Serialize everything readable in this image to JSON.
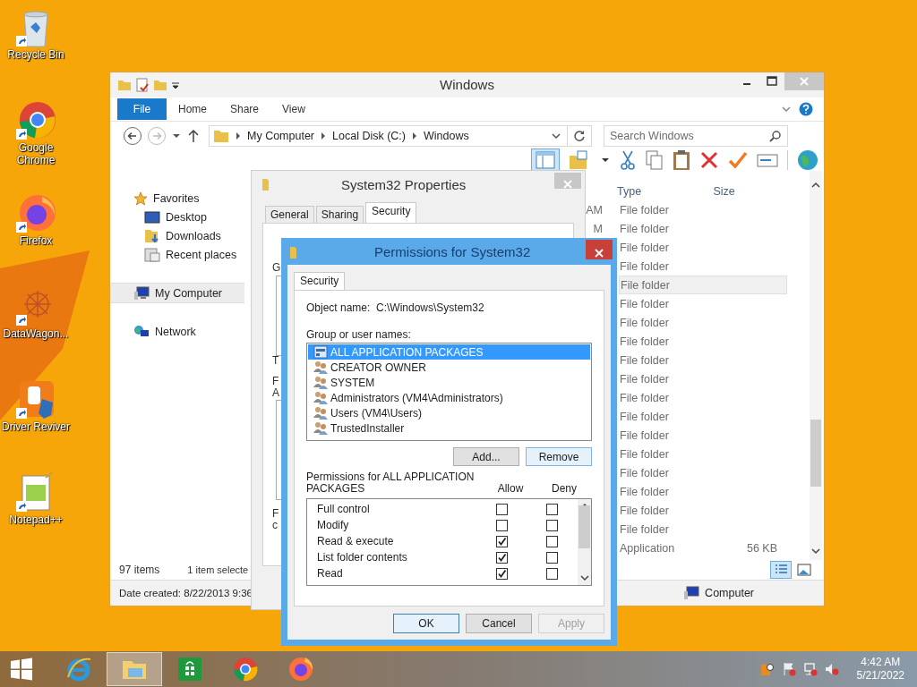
{
  "desktop_icons": [
    {
      "kind": "recycle",
      "label": "Recycle Bin"
    },
    {
      "kind": "chrome",
      "label": "Google Chrome"
    },
    {
      "kind": "firefox",
      "label": "Firefox"
    },
    {
      "kind": "datawagon",
      "label": "DataWagon..."
    },
    {
      "kind": "driver",
      "label": "Driver Reviver"
    },
    {
      "kind": "notepad",
      "label": "Notepad++"
    }
  ],
  "explorer": {
    "title": "Windows",
    "file_tab": "File",
    "ribbon_tabs": [
      "Home",
      "Share",
      "View"
    ],
    "breadcrumb": [
      "My Computer",
      "Local Disk (C:)",
      "Windows"
    ],
    "search": {
      "placeholder": "Search Windows"
    },
    "nav": [
      {
        "label": "Favorites",
        "kind": "favorites",
        "selected": false,
        "children": [
          {
            "label": "Desktop",
            "kind": "desktop",
            "selected": false
          },
          {
            "label": "Downloads",
            "kind": "downloads",
            "selected": false
          },
          {
            "label": "Recent places",
            "kind": "recent",
            "selected": false
          }
        ]
      },
      {
        "label": "My Computer",
        "kind": "computer",
        "selected": true
      },
      {
        "label": "Network",
        "kind": "network",
        "selected": false
      }
    ],
    "columns": [
      "Type",
      "Size"
    ],
    "rows": [
      {
        "date": "AM",
        "type": "File folder",
        "selected": false
      },
      {
        "date": "M",
        "type": "File folder",
        "selected": false
      },
      {
        "type": "File folder",
        "selected": false
      },
      {
        "type": "File folder",
        "selected": false
      },
      {
        "type": "File folder",
        "selected": true
      },
      {
        "type": "File folder",
        "selected": false
      },
      {
        "type": "File folder",
        "selected": false
      },
      {
        "type": "File folder",
        "selected": false
      },
      {
        "type": "File folder",
        "selected": false
      },
      {
        "type": "File folder",
        "selected": false
      },
      {
        "type": "File folder",
        "selected": false
      },
      {
        "type": "File folder",
        "selected": false
      },
      {
        "type": "File folder",
        "selected": false
      },
      {
        "type": "File folder",
        "selected": false
      },
      {
        "type": "File folder",
        "selected": false
      },
      {
        "type": "File folder",
        "selected": false
      },
      {
        "type": "File folder",
        "selected": false
      },
      {
        "type": "File folder",
        "selected": false
      },
      {
        "type": "Application",
        "size": "56 KB",
        "selected": false
      }
    ],
    "status": {
      "count": "97 items",
      "selection": "1 item selecte",
      "details": "Date created: 8/22/2013 9:36",
      "location": "Computer"
    }
  },
  "properties": {
    "title": "System32 Properties",
    "tabs": [
      {
        "label": "General",
        "selected": false
      },
      {
        "label": "Sharing",
        "selected": false
      },
      {
        "label": "Security",
        "selected": true
      }
    ],
    "fragments": [
      "G",
      "T",
      "F",
      "A",
      "F",
      "c"
    ]
  },
  "permissions": {
    "title": "Permissions for System32",
    "tab": "Security",
    "object_label": "Object name:",
    "object_value": "C:\\Windows\\System32",
    "group_label": "Group or user names:",
    "principals": [
      {
        "name": "ALL APPLICATION PACKAGES",
        "kind": "package",
        "selected": true
      },
      {
        "name": "CREATOR OWNER",
        "kind": "group",
        "selected": false
      },
      {
        "name": "SYSTEM",
        "kind": "group",
        "selected": false
      },
      {
        "name": "Administrators (VM4\\Administrators)",
        "kind": "group",
        "selected": false
      },
      {
        "name": "Users (VM4\\Users)",
        "kind": "group",
        "selected": false
      },
      {
        "name": "TrustedInstaller",
        "kind": "group",
        "selected": false
      }
    ],
    "list_buttons": [
      {
        "label": "Add...",
        "hover": false
      },
      {
        "label": "Remove",
        "hover": true
      }
    ],
    "perm_label": "Permissions for ALL APPLICATION PACKAGES",
    "allow_label": "Allow",
    "deny_label": "Deny",
    "perms": [
      {
        "name": "Full control",
        "allow": false,
        "deny": false
      },
      {
        "name": "Modify",
        "allow": false,
        "deny": false
      },
      {
        "name": "Read & execute",
        "allow": true,
        "deny": false
      },
      {
        "name": "List folder contents",
        "allow": true,
        "deny": false
      },
      {
        "name": "Read",
        "allow": true,
        "deny": false
      }
    ],
    "buttons": [
      {
        "label": "OK",
        "default": true,
        "disabled": false
      },
      {
        "label": "Cancel",
        "default": false,
        "disabled": false
      },
      {
        "label": "Apply",
        "default": false,
        "disabled": true
      }
    ]
  },
  "taskbar": {
    "apps": [
      {
        "kind": "ie",
        "selected": false
      },
      {
        "kind": "explorer",
        "selected": true
      },
      {
        "kind": "store",
        "selected": false
      },
      {
        "kind": "chrome",
        "selected": false
      },
      {
        "kind": "firefox",
        "selected": false
      }
    ],
    "time": "4:42 AM",
    "date": "5/21/2022"
  }
}
